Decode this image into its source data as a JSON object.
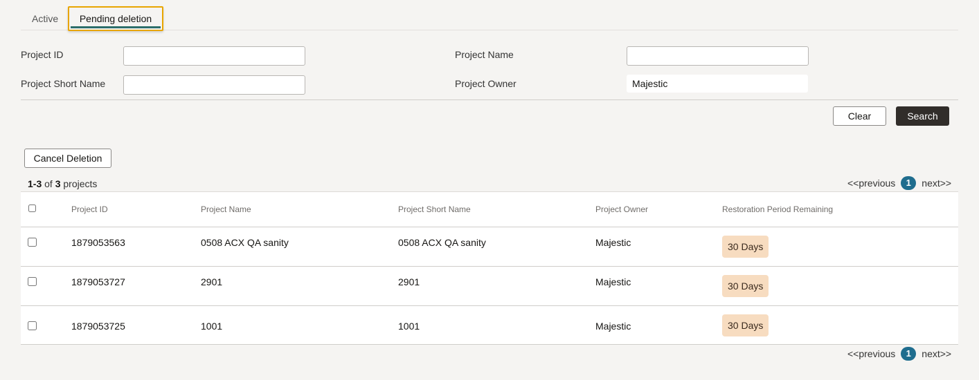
{
  "tabs": [
    {
      "label": "Active"
    },
    {
      "label": "Pending deletion"
    }
  ],
  "filters": {
    "project_id": {
      "label": "Project ID",
      "value": ""
    },
    "project_name": {
      "label": "Project Name",
      "value": ""
    },
    "project_short_name": {
      "label": "Project Short Name",
      "value": ""
    },
    "project_owner": {
      "label": "Project Owner",
      "value": "Majestic"
    }
  },
  "buttons": {
    "clear": "Clear",
    "search": "Search",
    "cancel_deletion": "Cancel Deletion"
  },
  "count": {
    "range": "1-3",
    "of": "of",
    "total": "3",
    "suffix": "projects"
  },
  "pager": {
    "previous": "<<previous",
    "page": "1",
    "next": "next>>"
  },
  "table": {
    "headers": [
      "Project ID",
      "Project Name",
      "Project Short Name",
      "Project Owner",
      "Restoration Period Remaining"
    ],
    "rows": [
      {
        "id": "1879053563",
        "name": "0508 ACX QA sanity",
        "short_name": "0508 ACX QA sanity",
        "owner": "Majestic",
        "restoration": "30 Days"
      },
      {
        "id": "1879053727",
        "name": "2901",
        "short_name": "2901",
        "owner": "Majestic",
        "restoration": "30 Days"
      },
      {
        "id": "1879053725",
        "name": "1001",
        "short_name": "1001",
        "owner": "Majestic",
        "restoration": "30 Days"
      }
    ]
  },
  "colors": {
    "focus_ring": "#e8a500",
    "active_tab_underline": "#2c6e6a",
    "page_badge": "#1f6d8e",
    "restoration_badge": "#f7dcc0",
    "primary_button": "#312d2a"
  }
}
